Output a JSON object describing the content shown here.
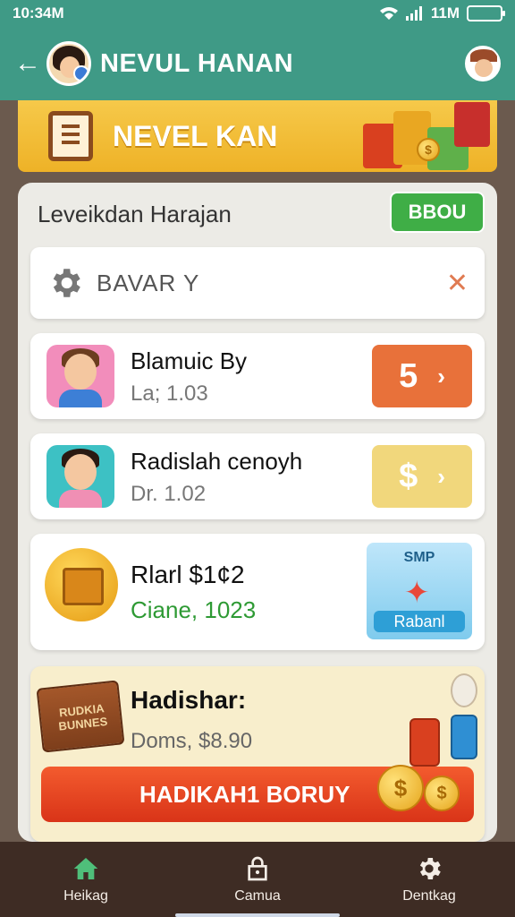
{
  "status_bar": {
    "time": "10:34M",
    "network": "11M"
  },
  "header": {
    "title": "NEVUL HANAN"
  },
  "banner": {
    "title": "NEVEL KAN"
  },
  "panel": {
    "title": "Leveikdan Harajan",
    "badge_label": "BBOU",
    "search": {
      "value": "BAVAR  Y",
      "clear_icon": "close-icon"
    },
    "cards": [
      {
        "name": "Blamuic By",
        "sub": "La; 1.03",
        "action": "5",
        "action_color": "#e8713a"
      },
      {
        "name": "Radislah cenoyh",
        "sub": "Dr. 1.02",
        "action": "$",
        "action_color": "#f1d77c"
      }
    ],
    "special": {
      "name": "Rlarl $1¢2",
      "sub": "Ciane, 1023",
      "sub_color": "#2e9a34",
      "badge_top": "SMP",
      "badge_bottom": "Rabanl"
    },
    "promo": {
      "box_label": "RUDKIA BUNNES",
      "title": "Hadishar:",
      "sub": "Doms, $8.90",
      "button": "HADIKAH1 BORUY"
    }
  },
  "bottom_nav": [
    {
      "label": "Heikag",
      "icon": "home-icon"
    },
    {
      "label": "Camua",
      "icon": "lock-icon"
    },
    {
      "label": "Dentkag",
      "icon": "gear-icon"
    }
  ],
  "colors": {
    "accent": "#3f9a86",
    "nav_bg": "#3e2c24",
    "panel_bg": "#ecebe6"
  }
}
